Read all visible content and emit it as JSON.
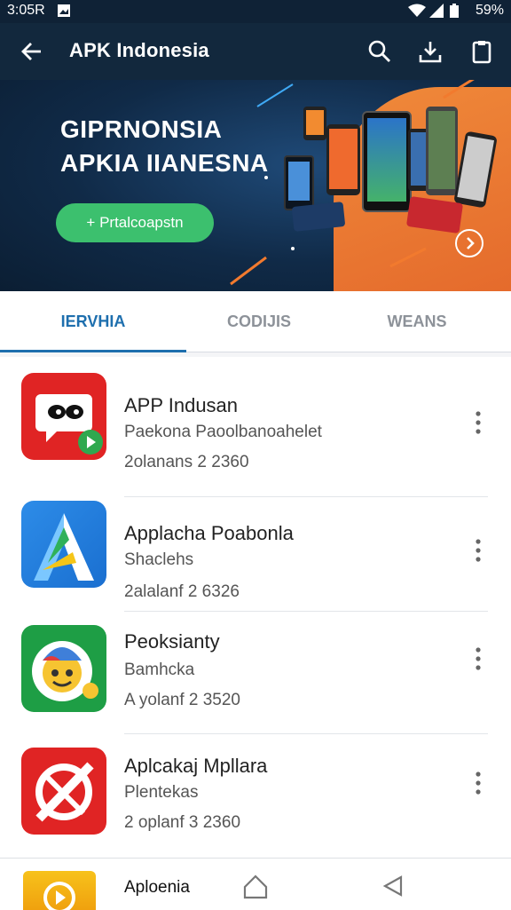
{
  "status_bar": {
    "time": "3:05R",
    "battery": "59%",
    "icons": [
      "gallery-icon",
      "wifi-icon",
      "signal-icon",
      "battery-icon"
    ]
  },
  "app_bar": {
    "title": "APK Indonesia",
    "icons": [
      "back-arrow-icon",
      "search-icon",
      "download-icon",
      "clipboard-icon"
    ]
  },
  "banner": {
    "title_line1": "GIPRNONSIA",
    "title_line2": "APKIA IIANESNA",
    "cta_label": "+ Prtalcoapstn",
    "colors": {
      "background": "#102a47",
      "accent": "#e3662a",
      "cta": "#3cc06e"
    }
  },
  "tabs": [
    {
      "label": "IERVHIA",
      "active": true
    },
    {
      "label": "CODIJIS",
      "active": false
    },
    {
      "label": "WEANS",
      "active": false
    }
  ],
  "apps": [
    {
      "name": "APP Indusan",
      "developer": "Paekona  Paoolbanoahelet",
      "meta": "2olanans  2  2360",
      "icon": "chat-bot-icon"
    },
    {
      "name": "Applacha Poabonla",
      "developer": "Shaclehs",
      "meta": "2alalanf  2  6326",
      "icon": "triangle-a-logo-icon"
    },
    {
      "name": "Peoksianty",
      "developer": "Bamhcka",
      "meta": "A yolanf  2  3520",
      "icon": "smiley-face-icon"
    },
    {
      "name": "Aplcakaj Mpllara",
      "developer": "Plentekas",
      "meta": "2 oplanf  3  2360",
      "icon": "cross-out-icon"
    }
  ],
  "bottom_nav": {
    "label": "Aploenia",
    "icons": [
      "play-app-icon",
      "home-icon",
      "back-triangle-icon"
    ]
  },
  "colors": {
    "primary": "#12283d",
    "tab_active": "#1e6fae"
  }
}
